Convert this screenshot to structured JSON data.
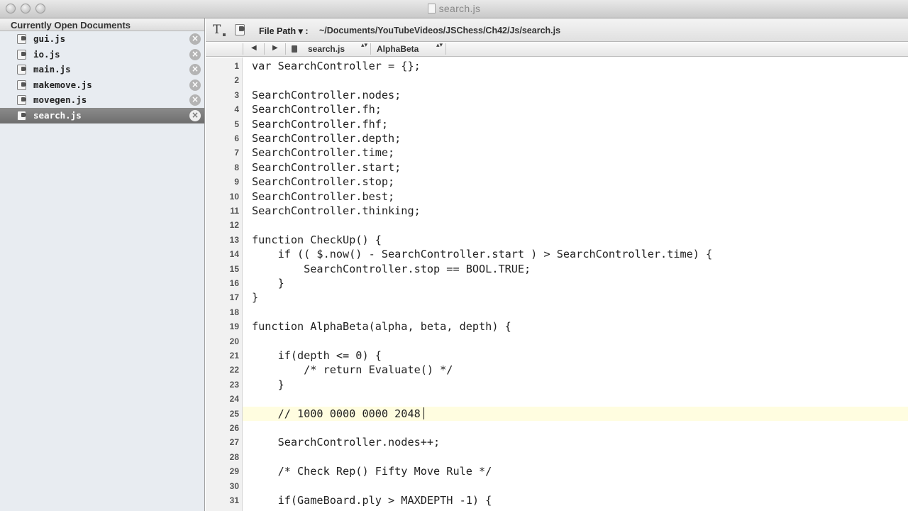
{
  "window": {
    "title": "search.js"
  },
  "sidebar": {
    "header": "Currently Open Documents",
    "files": [
      {
        "name": "gui.js",
        "selected": false
      },
      {
        "name": "io.js",
        "selected": false
      },
      {
        "name": "main.js",
        "selected": false
      },
      {
        "name": "makemove.js",
        "selected": false
      },
      {
        "name": "movegen.js",
        "selected": false
      },
      {
        "name": "search.js",
        "selected": true
      }
    ],
    "close_glyph": "×"
  },
  "toolbar": {
    "text_tool_glyph": "T",
    "file_path_label": "File Path ▾ :",
    "file_path_value": "~/Documents/YouTubeVideos/JSChess/Ch42/Js/search.js"
  },
  "navbar": {
    "back_glyph": "◀",
    "forward_glyph": "▶",
    "current_file": "search.js",
    "current_function": "AlphaBeta",
    "updown_glyph": "▴▾"
  },
  "editor": {
    "current_line": 25,
    "lines": [
      {
        "n": "1",
        "text": "var SearchController = {};"
      },
      {
        "n": "2",
        "text": ""
      },
      {
        "n": "3",
        "text": "SearchController.nodes;"
      },
      {
        "n": "4",
        "text": "SearchController.fh;"
      },
      {
        "n": "5",
        "text": "SearchController.fhf;"
      },
      {
        "n": "6",
        "text": "SearchController.depth;"
      },
      {
        "n": "7",
        "text": "SearchController.time;"
      },
      {
        "n": "8",
        "text": "SearchController.start;"
      },
      {
        "n": "9",
        "text": "SearchController.stop;"
      },
      {
        "n": "10",
        "text": "SearchController.best;"
      },
      {
        "n": "11",
        "text": "SearchController.thinking;"
      },
      {
        "n": "12",
        "text": ""
      },
      {
        "n": "13",
        "text": "function CheckUp() {"
      },
      {
        "n": "14",
        "text": "    if (( $.now() - SearchController.start ) > SearchController.time) {"
      },
      {
        "n": "15",
        "text": "        SearchController.stop == BOOL.TRUE;"
      },
      {
        "n": "16",
        "text": "    }"
      },
      {
        "n": "17",
        "text": "}"
      },
      {
        "n": "18",
        "text": ""
      },
      {
        "n": "19",
        "text": "function AlphaBeta(alpha, beta, depth) {"
      },
      {
        "n": "20",
        "text": ""
      },
      {
        "n": "21",
        "text": "    if(depth <= 0) {"
      },
      {
        "n": "22",
        "text": "        /* return Evaluate() */"
      },
      {
        "n": "23",
        "text": "    }"
      },
      {
        "n": "24",
        "text": ""
      },
      {
        "n": "25",
        "text": "    // 1000 0000 0000 2048"
      },
      {
        "n": "26",
        "text": ""
      },
      {
        "n": "27",
        "text": "    SearchController.nodes++;"
      },
      {
        "n": "28",
        "text": ""
      },
      {
        "n": "29",
        "text": "    /* Check Rep() Fifty Move Rule */"
      },
      {
        "n": "30",
        "text": ""
      },
      {
        "n": "31",
        "text": "    if(GameBoard.ply > MAXDEPTH -1) {"
      }
    ]
  }
}
